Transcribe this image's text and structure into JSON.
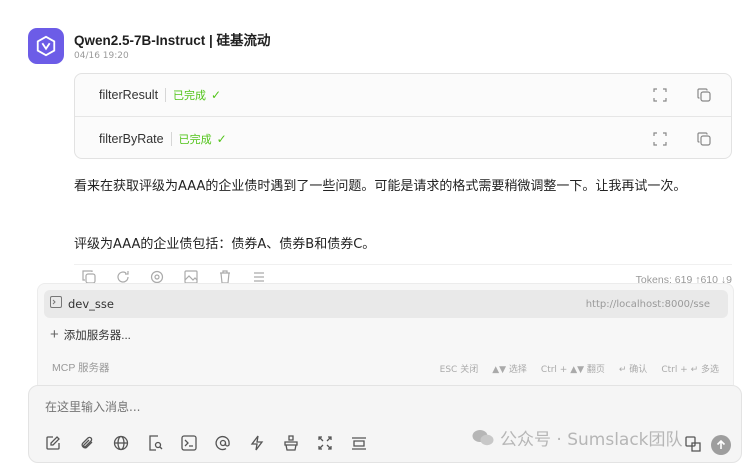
{
  "message": {
    "model_name": "Qwen2.5-7B-Instruct | 硅基流动",
    "timestamp": "04/16 19:20",
    "tool_calls": [
      {
        "name": "filterResult",
        "status": "已完成"
      },
      {
        "name": "filterByRate",
        "status": "已完成"
      }
    ],
    "paragraphs": [
      "看来在获取评级为AAA的企业债时遇到了一些问题。可能是请求的格式需要稍微调整一下。让我再试一次。",
      "评级为AAA的企业债包括：债券A、债券B和债券C。"
    ],
    "tokens": "Tokens: 619 ↑610 ↓9"
  },
  "mcp_panel": {
    "server": {
      "name": "dev_sse",
      "url": "http://localhost:8000/sse"
    },
    "add_label": "添加服务器...",
    "footer_title": "MCP 服务器",
    "hints": [
      "ESC 关闭",
      "▲▼ 选择",
      "Ctrl + ▲▼ 翻页",
      "↵ 确认",
      "Ctrl + ↵ 多选"
    ]
  },
  "input": {
    "placeholder": "在这里输入消息..."
  },
  "watermark": "公众号 · Sumslack团队",
  "colors": {
    "accent": "#6c5ce7",
    "success": "#52c41a"
  },
  "icons": {
    "tool_row": [
      "expand-icon",
      "copy-icon"
    ],
    "message_actions": [
      "copy-icon",
      "refresh-icon",
      "mention-icon",
      "image-icon",
      "delete-icon",
      "menu-icon"
    ],
    "toolbar": [
      "edit-icon",
      "attachment-icon",
      "globe-icon",
      "search-doc-icon",
      "terminal-icon",
      "at-icon",
      "flash-icon",
      "clean-icon",
      "fullscreen-icon",
      "more-icon"
    ]
  }
}
